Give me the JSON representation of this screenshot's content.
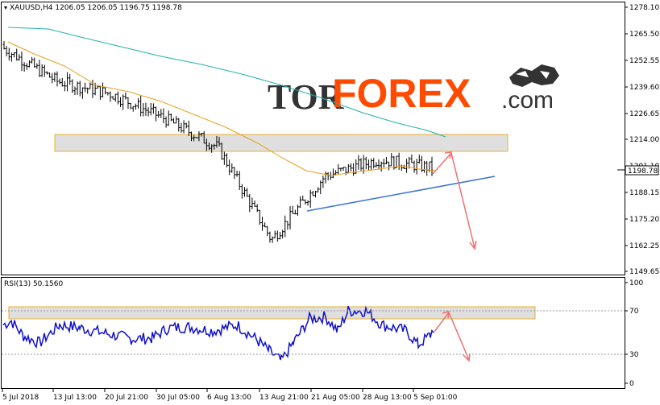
{
  "price_panel": {
    "header": "XAUUSD,H4  1206.05 1206.05 1196.75 1198.78",
    "y_ticks": [
      "1278.10",
      "1265.50",
      "1252.55",
      "1239.60",
      "1226.65",
      "1214.00",
      "1201.10",
      "1188.15",
      "1175.20",
      "1162.25",
      "1149.65"
    ],
    "current_price_label": "1198.78"
  },
  "rsi_panel": {
    "header": "RSI(13) 50.1560",
    "y_ticks": [
      "100",
      "70",
      "30",
      "0"
    ]
  },
  "x_axis": {
    "labels": [
      "5 Jul 2018",
      "13 Jul 13:00",
      "20 Jul 21:00",
      "30 Jul 05:00",
      "6 Aug 13:00",
      "13 Aug 21:00",
      "21 Aug 05:00",
      "28 Aug 13:00",
      "5 Sep 01:00"
    ]
  },
  "logo": {
    "part1": "TOR",
    "part2": "FOREX",
    "part3": ".com"
  },
  "colors": {
    "candles": "#000000",
    "ma_fast": "#e6a020",
    "ma_slow": "#20b2aa",
    "trend_line": "#3a72d8",
    "forecast_arrow": "#f07070",
    "resistance_zone_fill": "#d9d9d9",
    "resistance_zone_border": "#e8b030",
    "rsi_line": "#1010cc",
    "accent": "#ff4a00"
  },
  "chart_data": {
    "type": "line",
    "title": "",
    "xlabel": "",
    "ylabel": "",
    "ylim": [
      1149.65,
      1278.1
    ],
    "x": [
      "5 Jul 2018",
      "13 Jul 13:00",
      "20 Jul 21:00",
      "30 Jul 05:00",
      "6 Aug 13:00",
      "13 Aug 21:00",
      "21 Aug 05:00",
      "28 Aug 13:00",
      "5 Sep 01:00"
    ],
    "series": [
      {
        "values": [
          1258.0,
          1242.0,
          1236.0,
          1224.0,
          1210.0,
          1165.0,
          1196.0,
          1204.0,
          1200.0
        ]
      },
      {
        "values": [
          1262.0,
          1242.0,
          1232.0,
          1224.0,
          1212.0,
          1196.0,
          1194.0,
          1200.0,
          1199.0
        ]
      },
      {
        "values": [
          1278.0,
          1266.0,
          1255.0,
          1244.0,
          1234.0,
          1225.0,
          1219.0,
          1216.0,
          1214.0
        ]
      }
    ],
    "rsi": {
      "ylim": [
        0,
        100
      ],
      "levels": [
        70,
        30
      ],
      "last": 50.156
    }
  }
}
